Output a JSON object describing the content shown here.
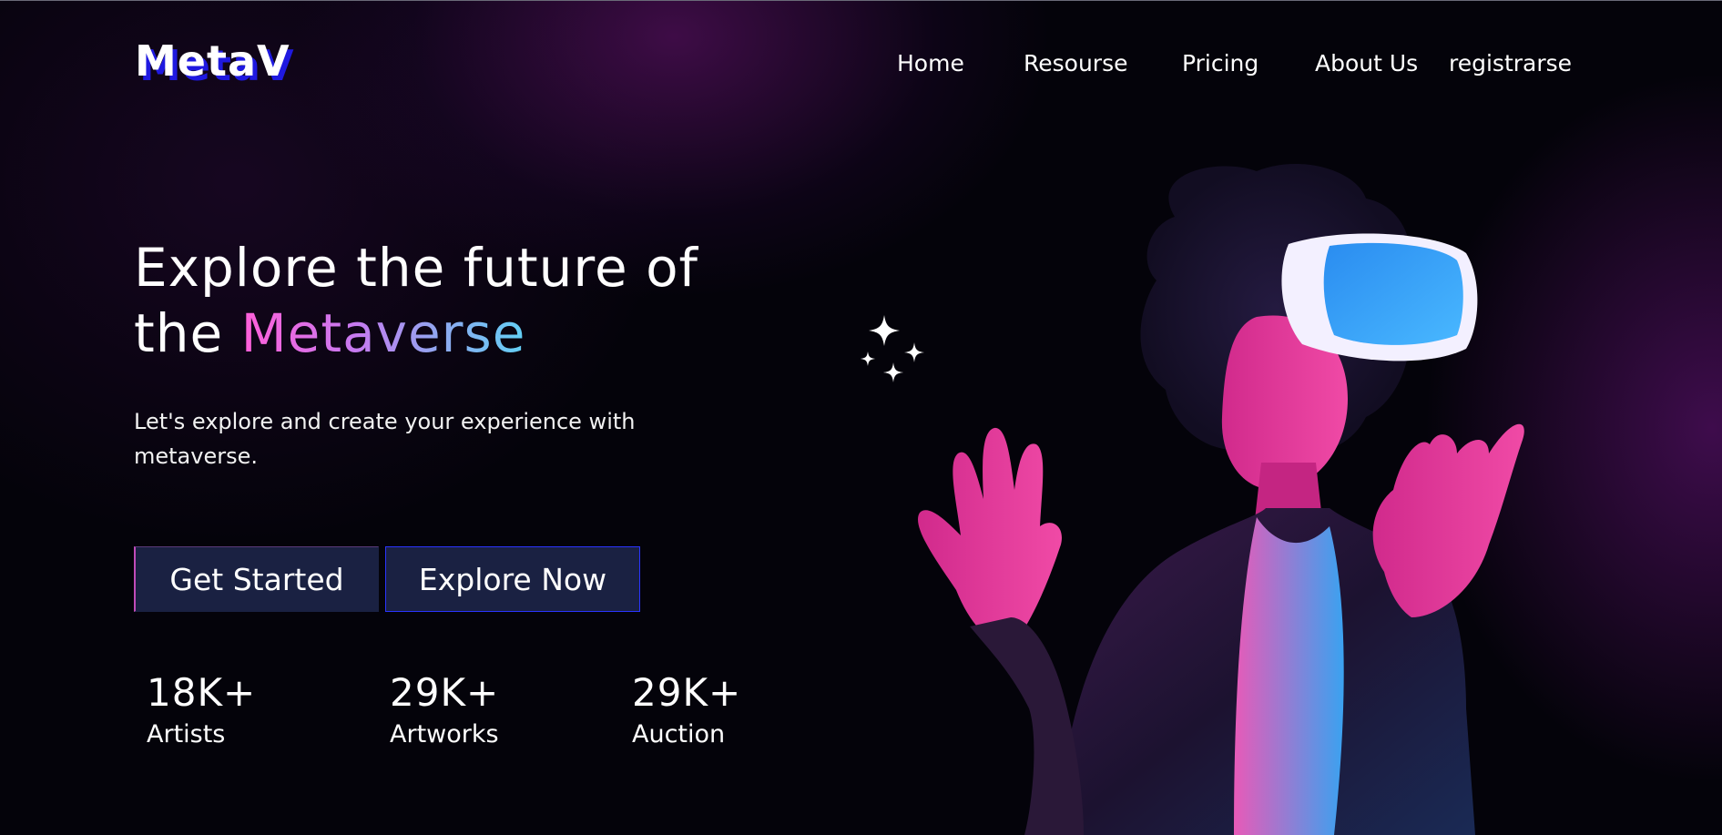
{
  "brand": {
    "logo_text": "MetaV"
  },
  "nav": {
    "items": [
      "Home",
      "Resourse",
      "Pricing",
      "About Us",
      "registrarse"
    ]
  },
  "hero": {
    "title_line1": "Explore the future of",
    "title_line2_prefix": "the ",
    "title_accent": "Metaverse",
    "subtitle": "Let's explore and create your experience with metaverse.",
    "primary_button": "Get Started",
    "secondary_button": "Explore Now"
  },
  "stats": [
    {
      "value": "18K+",
      "label": "Artists"
    },
    {
      "value": "29K+",
      "label": "Artworks"
    },
    {
      "value": "29K+",
      "label": "Auction"
    }
  ],
  "colors": {
    "background": "#04030a",
    "logo_shadow": "#1f19e0",
    "button_bg": "#1a2142",
    "accent_gradient_start": "#ff5fd8",
    "accent_gradient_end": "#62d0f5"
  },
  "icons": {
    "sparkles": "sparkles-icon"
  }
}
